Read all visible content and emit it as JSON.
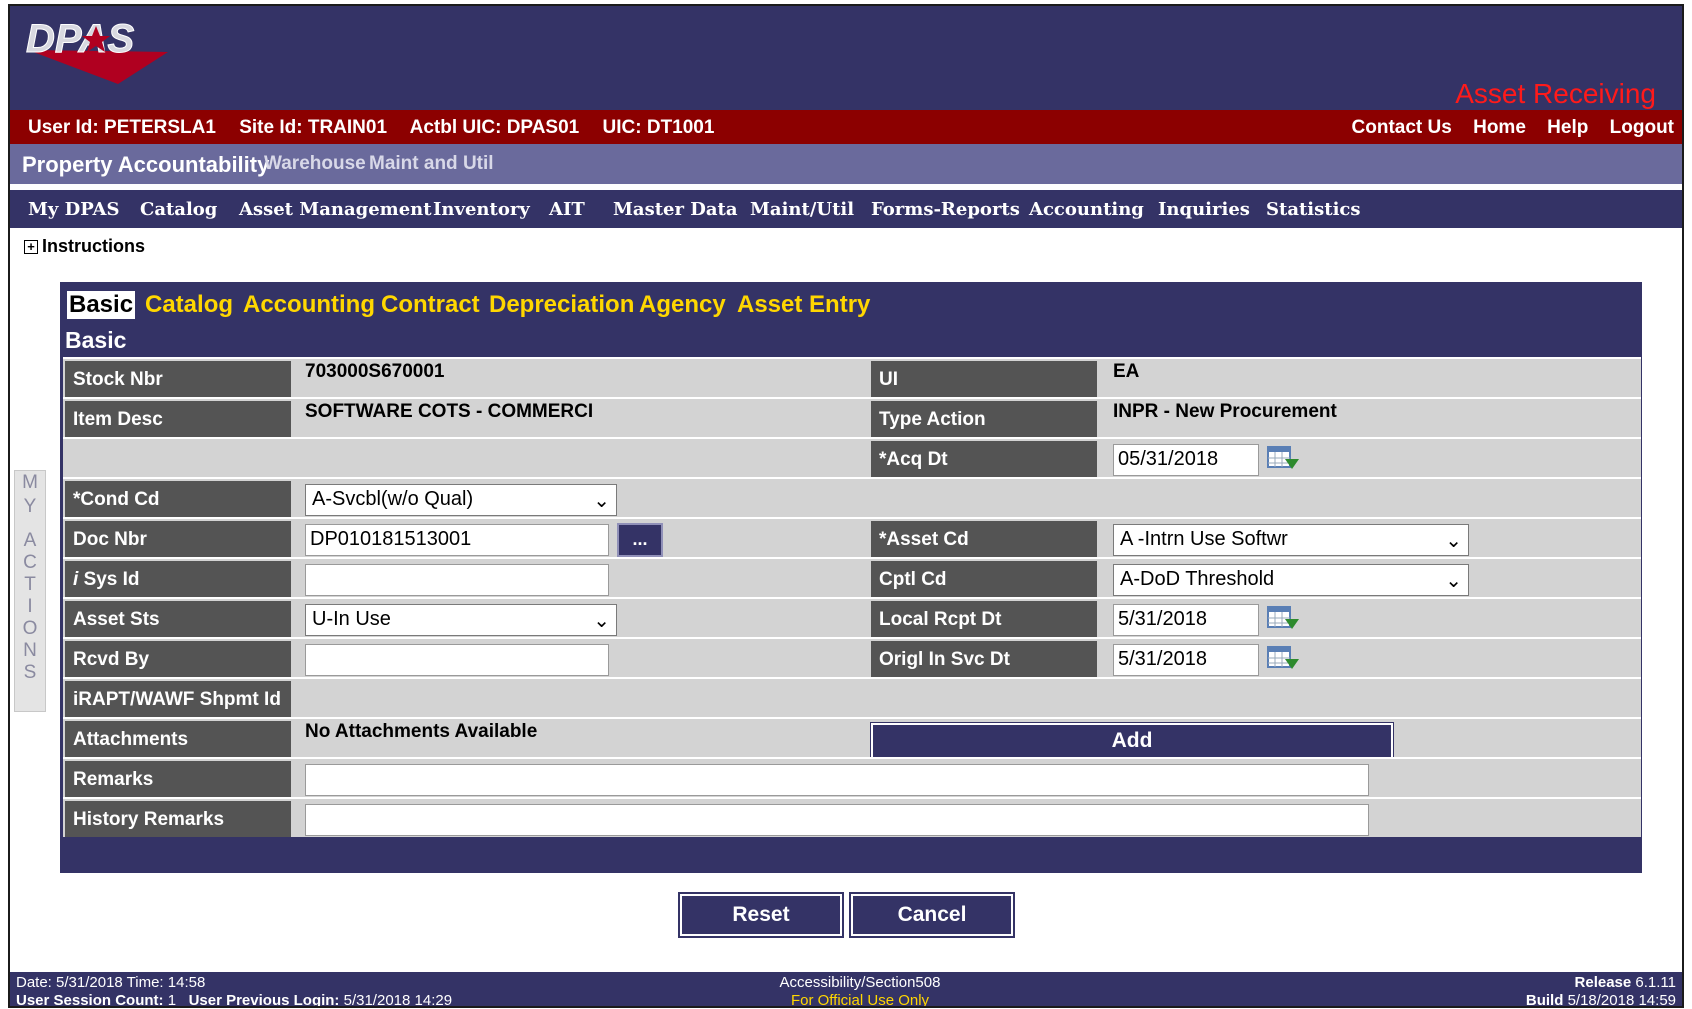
{
  "header": {
    "logo_text": "DPAS",
    "page_title": "Asset Receiving"
  },
  "userbar": {
    "user_id": "User Id: PETERSLA1",
    "site_id": "Site Id: TRAIN01",
    "actbl_uic": "Actbl UIC: DPAS01",
    "uic": "UIC: DT1001",
    "links": [
      "Contact Us",
      "Home",
      "Help",
      "Logout"
    ]
  },
  "propbar": {
    "main": "Property Accountability",
    "sub": [
      "Warehouse",
      "Maint and Util"
    ]
  },
  "menu": [
    "My DPAS",
    "Catalog",
    "Asset Management",
    "Inventory",
    "AIT",
    "Master Data",
    "Maint/Util",
    "Forms-Reports",
    "Accounting",
    "Inquiries",
    "Statistics"
  ],
  "instructions_label": "Instructions",
  "my_actions": [
    "M",
    "Y",
    "",
    "A",
    "C",
    "T",
    "I",
    "O",
    "N",
    "S"
  ],
  "tabs": [
    "Basic",
    "Catalog",
    "Accounting",
    "Contract",
    "Depreciation",
    "Agency",
    "Asset Entry"
  ],
  "section_title": "Basic",
  "form": {
    "stock_nbr": {
      "label": "Stock Nbr",
      "value": "703000S670001"
    },
    "ui": {
      "label": "UI",
      "value": "EA"
    },
    "item_desc": {
      "label": "Item Desc",
      "value": "SOFTWARE COTS - COMMERCI"
    },
    "type_action": {
      "label": "Type Action",
      "value": "INPR - New Procurement"
    },
    "acq_dt": {
      "label": "*Acq Dt",
      "value": "05/31/2018"
    },
    "cond_cd": {
      "label": "*Cond Cd",
      "value": "A-Svcbl(w/o Qual)"
    },
    "doc_nbr": {
      "label": "Doc Nbr",
      "value": "DP010181513001",
      "button": "..."
    },
    "asset_cd": {
      "label": "*Asset Cd",
      "value": "A -Intrn Use Softwr"
    },
    "sys_id": {
      "label_prefix": "i",
      "label": "Sys Id",
      "value": ""
    },
    "cptl_cd": {
      "label": "Cptl Cd",
      "value": "A-DoD Threshold"
    },
    "asset_sts": {
      "label": "Asset Sts",
      "value": "U-In Use"
    },
    "local_rcpt_dt": {
      "label": "Local Rcpt Dt",
      "value": "5/31/2018"
    },
    "rcvd_by": {
      "label": "Rcvd By",
      "value": ""
    },
    "origl_in_svc_dt": {
      "label": "Origl In Svc Dt",
      "value": "5/31/2018"
    },
    "irapt": {
      "label": "iRAPT/WAWF Shpmt Id"
    },
    "attachments": {
      "label": "Attachments",
      "value": "No Attachments Available",
      "button": "Add"
    },
    "remarks": {
      "label": "Remarks",
      "value": ""
    },
    "history_remarks": {
      "label": "History Remarks",
      "value": ""
    }
  },
  "buttons": {
    "reset": "Reset",
    "cancel": "Cancel"
  },
  "footer": {
    "date_label": "Date: 5/31/2018 Time: 14:58",
    "session_label": "User Session Count:",
    "session_value": "1",
    "prev_login_label": "User Previous Login:",
    "prev_login_value": "5/31/2018 14:29",
    "accessibility": "Accessibility/Section508",
    "official": "For Official Use Only",
    "release_label": "Release",
    "release_value": "6.1.11",
    "build_label": "Build",
    "build_value": "5/18/2018 14:59"
  },
  "colors": {
    "header_navy": "#343366",
    "userbar_red": "#8c0000",
    "tab_yellow": "#ffd700",
    "label_gray": "#545454",
    "row_gray": "#d3d3d3",
    "title_red": "#ff1a1a"
  }
}
